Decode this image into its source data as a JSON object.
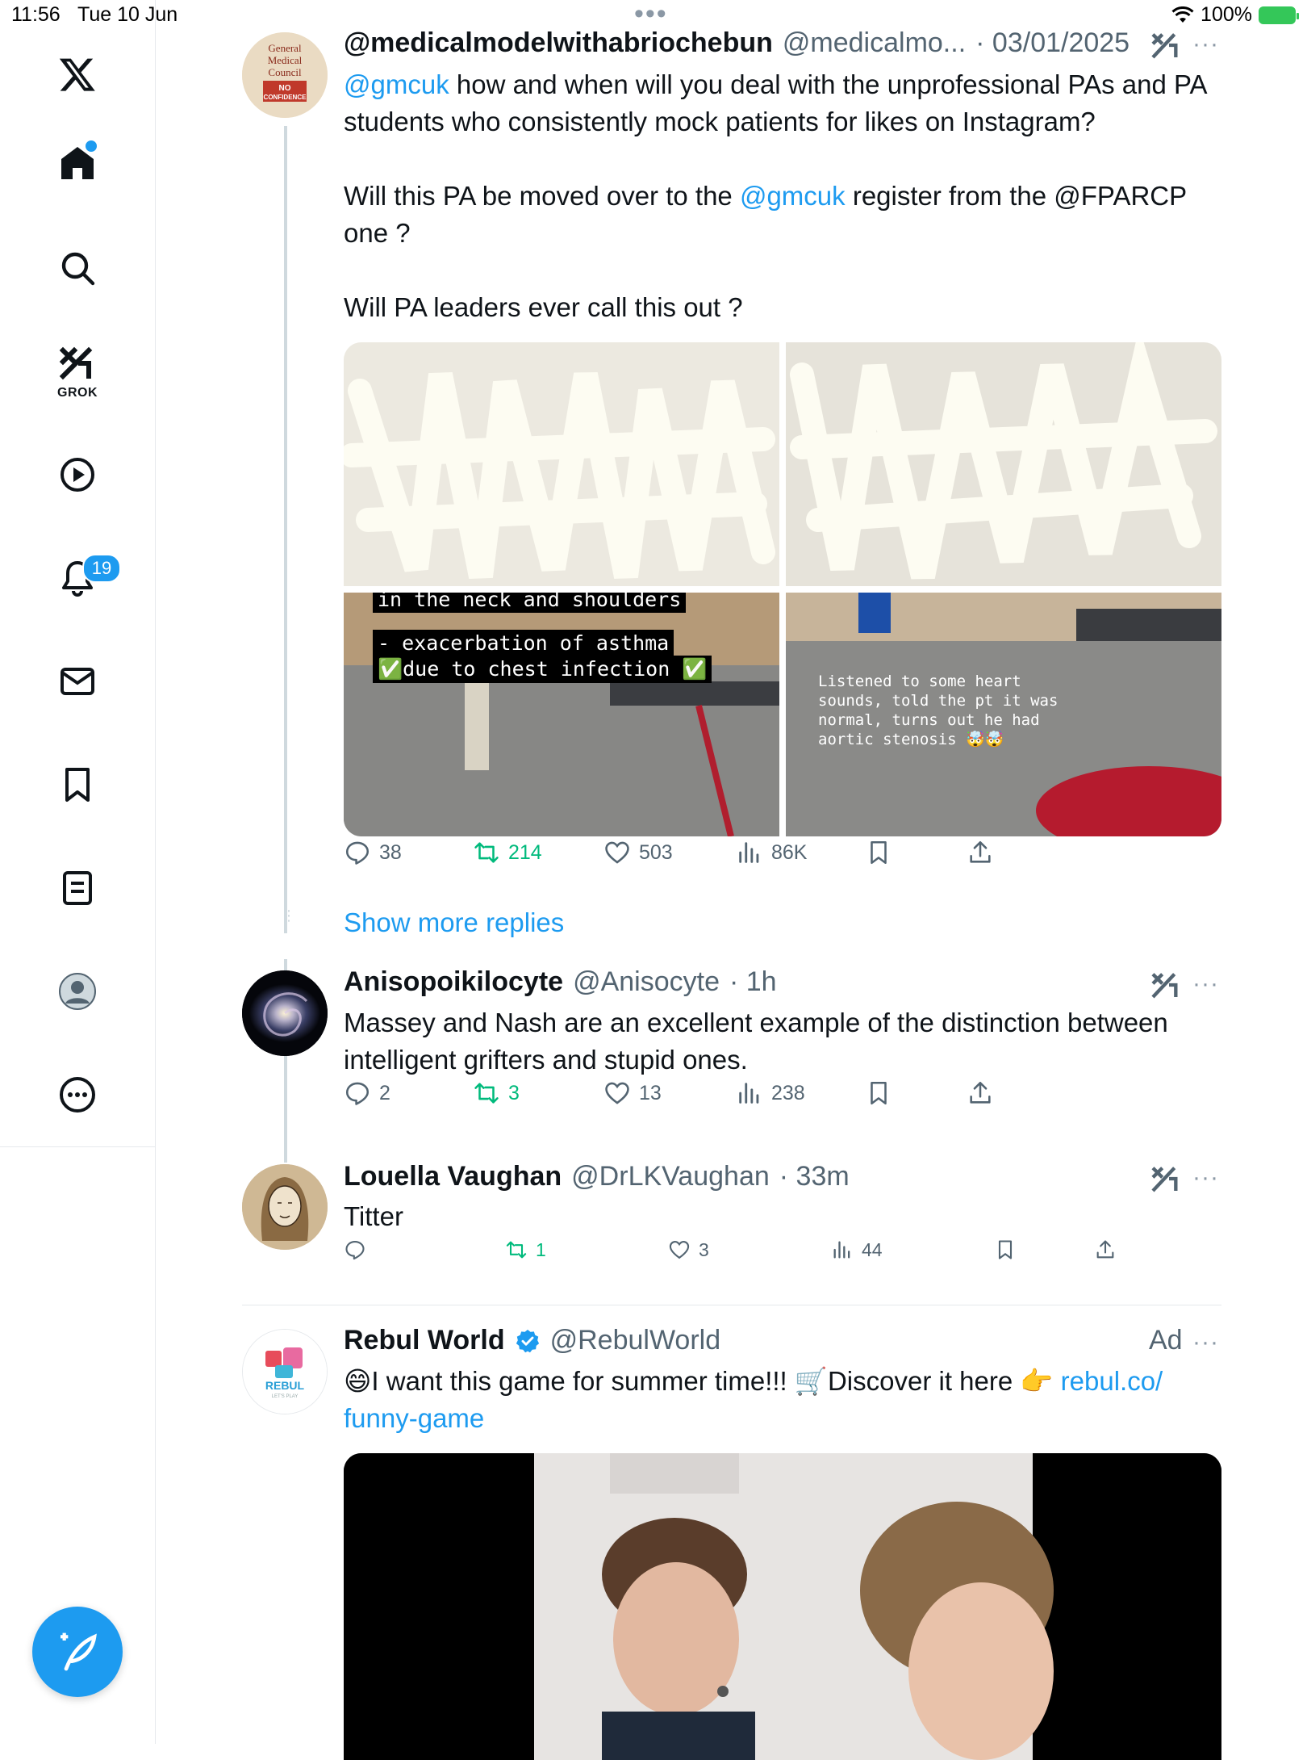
{
  "status_bar": {
    "time": "11:56",
    "date": "Tue 10 Jun",
    "battery": "100%",
    "multitask_dots": "•••"
  },
  "sidebar": {
    "grok_label": "GROK",
    "notification_count": "19"
  },
  "tweets": [
    {
      "name": "@medicalmodelwithabriochebun",
      "handle": "@medicalmo...",
      "time": "· 03/01/2025",
      "text_parts": {
        "mention1": "@gmcuk",
        "line1": " how and when will you deal with the unprofessional PAs and PA students who consistently mock patients for likes on Instagram?",
        "line2_pre": "Will this PA be moved over to the ",
        "mention2": "@gmcuk",
        "line2_post": " register from the @FPARCP one ?",
        "line3": "Will PA leaders ever call this out ?"
      },
      "media_captions": {
        "cap_top": "in the neck and shoulders",
        "cap_mid": "- exacerbation of asthma",
        "cap_bot": "✅due to chest infection ✅",
        "cap_right": "Listened to some heart\nsounds, told the pt it was\nnormal, turns out he had\naortic stenosis 🤯🤯"
      },
      "replies": "38",
      "reposts": "214",
      "likes": "503",
      "views": "86K",
      "avatar_text": [
        "General",
        "Medical",
        "Council",
        "NO",
        "CONFIDENCE"
      ]
    },
    {
      "name": "Anisopoikilocyte",
      "handle": "@Anisocyte",
      "time": "· 1h",
      "text": "Massey and Nash are an excellent example of the distinction between intelligent grifters and stupid ones.",
      "replies": "2",
      "reposts": "3",
      "likes": "13",
      "views": "238"
    },
    {
      "name": "Louella Vaughan",
      "handle": "@DrLKVaughan",
      "time": "· 33m",
      "text": "Titter",
      "replies": "",
      "reposts": "1",
      "likes": "3",
      "views": "44"
    }
  ],
  "show_more": "Show more replies",
  "ad": {
    "name": "Rebul World",
    "handle": "@RebulWorld",
    "label": "Ad",
    "text_pre": "😄I want this game for summer time!!! 🛒Discover it here 👉 ",
    "link": "rebul.co/ funny-game",
    "avatar_text": "REBUL",
    "avatar_sub": "LET'S PLAY"
  },
  "more_label": "···",
  "colors": {
    "accent": "#1d9bf0",
    "repost_green": "#00ba7c",
    "text_secondary": "#536471",
    "border": "#e6e9ec"
  }
}
